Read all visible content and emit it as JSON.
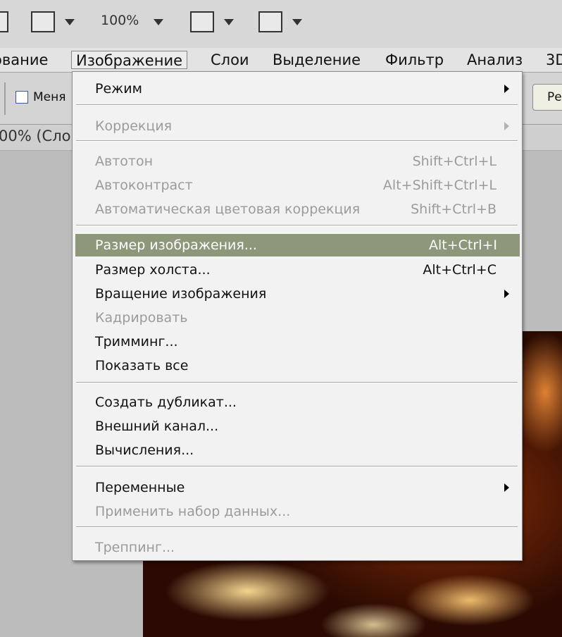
{
  "toolbar": {
    "zoom": "100%"
  },
  "menubar": {
    "items": [
      {
        "label": "ование"
      },
      {
        "label": "Изображение"
      },
      {
        "label": "Слои"
      },
      {
        "label": "Выделение"
      },
      {
        "label": "Фильтр"
      },
      {
        "label": "Анализ"
      },
      {
        "label": "3D"
      }
    ]
  },
  "options": {
    "checkbox_label": "Меня",
    "right_button": "Ре"
  },
  "document": {
    "tab_label": "00% (Сло"
  },
  "menu": {
    "mode": "Режим",
    "adjustments": "Коррекция",
    "auto_tone": "Автотон",
    "auto_tone_sc": "Shift+Ctrl+L",
    "auto_contrast": "Автоконтраст",
    "auto_contrast_sc": "Alt+Shift+Ctrl+L",
    "auto_color": "Автоматическая цветовая коррекция",
    "auto_color_sc": "Shift+Ctrl+B",
    "image_size": "Размер изображения...",
    "image_size_sc": "Alt+Ctrl+I",
    "canvas_size": "Размер холста...",
    "canvas_size_sc": "Alt+Ctrl+C",
    "rotation": "Вращение изображения",
    "crop": "Кадрировать",
    "trim": "Тримминг...",
    "reveal_all": "Показать все",
    "duplicate": "Создать дубликат...",
    "apply_image": "Внешний канал...",
    "calculations": "Вычисления...",
    "variables": "Переменные",
    "apply_data_set": "Применить набор данных...",
    "trap": "Треппинг..."
  },
  "colors": {
    "highlight": "#8d977a",
    "menu_bg": "#f2f2f2",
    "disabled_text": "#9b9b9b"
  }
}
